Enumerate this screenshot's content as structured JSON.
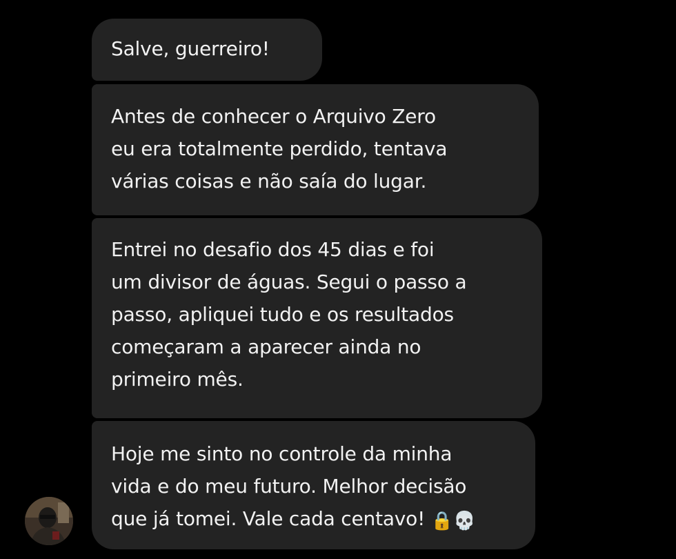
{
  "messages": [
    {
      "text": "Salve, guerreiro!"
    },
    {
      "text": "Antes de conhecer o Arquivo Zero\neu era totalmente perdido, tentava\nvárias coisas e não saía do lugar."
    },
    {
      "text": "Entrei no desafio dos 45 dias e foi\num divisor de águas. Segui o passo a\npasso, apliquei tudo e os resultados\ncomeçaram a aparecer ainda no\nprimeiro mês."
    },
    {
      "text": "Hoje me sinto no controle da minha\nvida e do meu futuro. Melhor decisão\nque já tomei. Vale cada centavo! ",
      "emojis": [
        "🔒",
        "💀"
      ]
    }
  ],
  "icons": {
    "avatar": "sender-avatar",
    "lock": "lock-icon",
    "skull": "skull-icon"
  },
  "colors": {
    "background": "#000000",
    "bubble": "#232323",
    "text": "#f2f2f2"
  }
}
